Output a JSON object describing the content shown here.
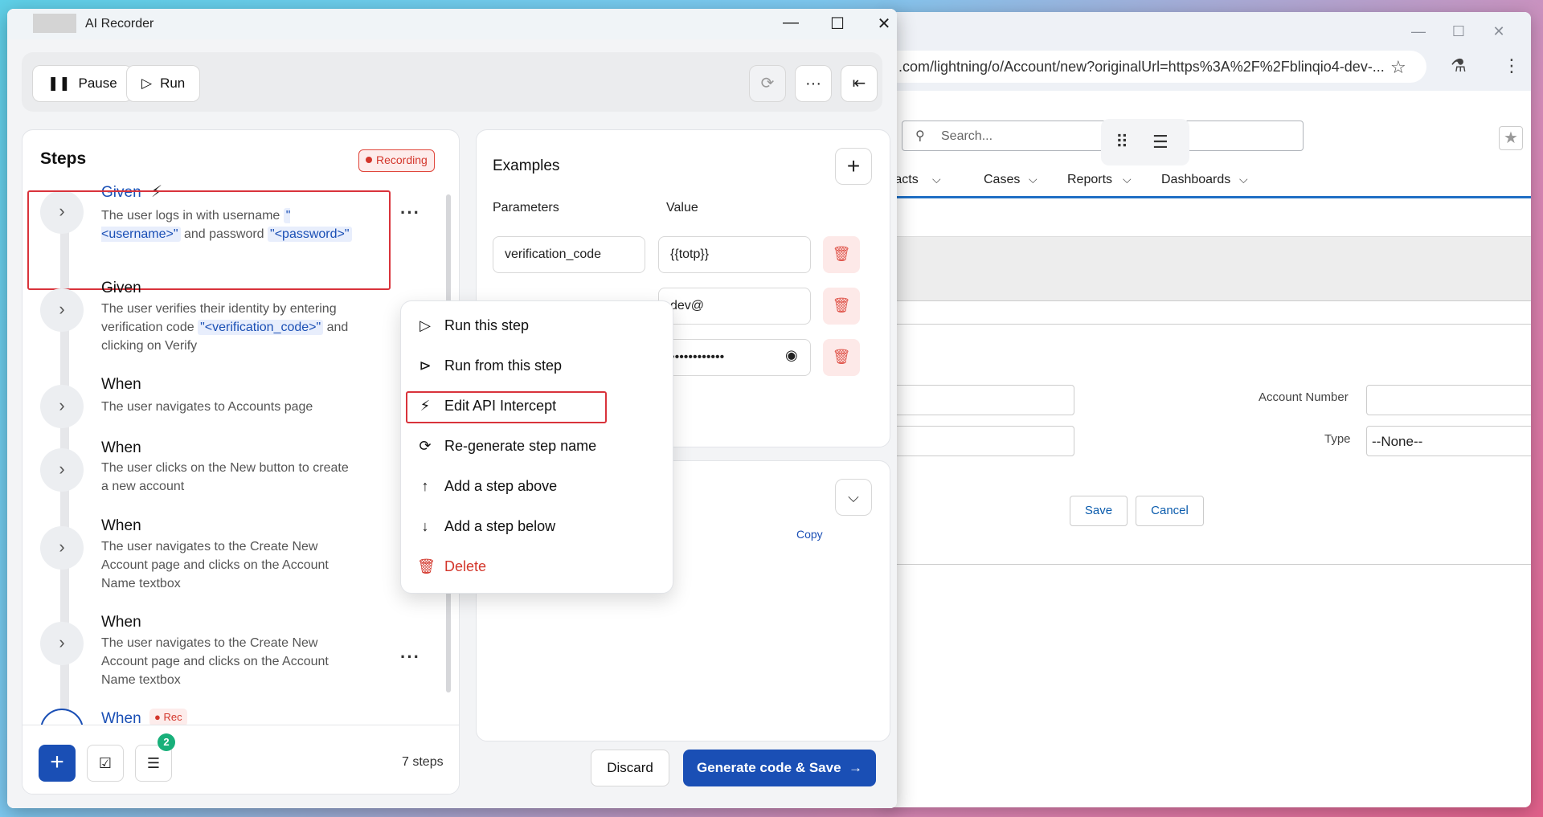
{
  "browser": {
    "url": ".com/lightning/o/Account/new?originalUrl=https%3A%2F%2Fblinqio4-dev-...",
    "search_placeholder": "Search...",
    "nav": [
      "ntacts",
      "Cases",
      "Reports",
      "Dashboards"
    ],
    "form": {
      "account_number_label": "Account Number",
      "type_label": "Type",
      "type_value": "--None--",
      "save_label": "Save",
      "cancel_label": "Cancel"
    }
  },
  "recorder": {
    "title": "AI Recorder",
    "toolbar": {
      "pause_label": "Pause",
      "run_label": "Run"
    },
    "steps_title": "Steps",
    "recording_badge": "Recording",
    "steps": [
      {
        "keyword": "Given",
        "text_1": "The user logs in with username ",
        "tag_1": "\"<username>\"",
        "text_2": " and password ",
        "tag_2": "\"<password>\""
      },
      {
        "keyword": "Given",
        "text_1": "The user verifies their identity by entering verification code ",
        "tag_1": "\"<verification_code>\"",
        "text_2": " and clicking on Verify"
      },
      {
        "keyword": "When",
        "text_1": "The user navigates to Accounts page"
      },
      {
        "keyword": "When",
        "text_1": "The user clicks on the New button to create a new account"
      },
      {
        "keyword": "When",
        "text_1": "The user navigates to the Create New Account page and clicks on the Account Name textbox"
      },
      {
        "keyword": "When",
        "text_1": "The user navigates to the Create New Account page and clicks on the Account Name textbox"
      },
      {
        "keyword": "When",
        "badge": "Rec"
      }
    ],
    "footer_badge": "2",
    "steps_count": "7 steps",
    "examples": {
      "title": "Examples",
      "col_parameters": "Parameters",
      "col_value": "Value",
      "rows": [
        {
          "param": "verification_code",
          "value": "{{totp}}"
        },
        {
          "param": "",
          "value": "dev@"
        },
        {
          "param": "",
          "value": "••••••••••••"
        }
      ]
    },
    "copy_label": "Copy",
    "discard_label": "Discard",
    "save_label": "Generate code & Save",
    "context_menu": [
      "Run this step",
      "Run from this step",
      "Edit API Intercept",
      "Re-generate step name",
      "Add a step above",
      "Add a step below",
      "Delete"
    ]
  }
}
